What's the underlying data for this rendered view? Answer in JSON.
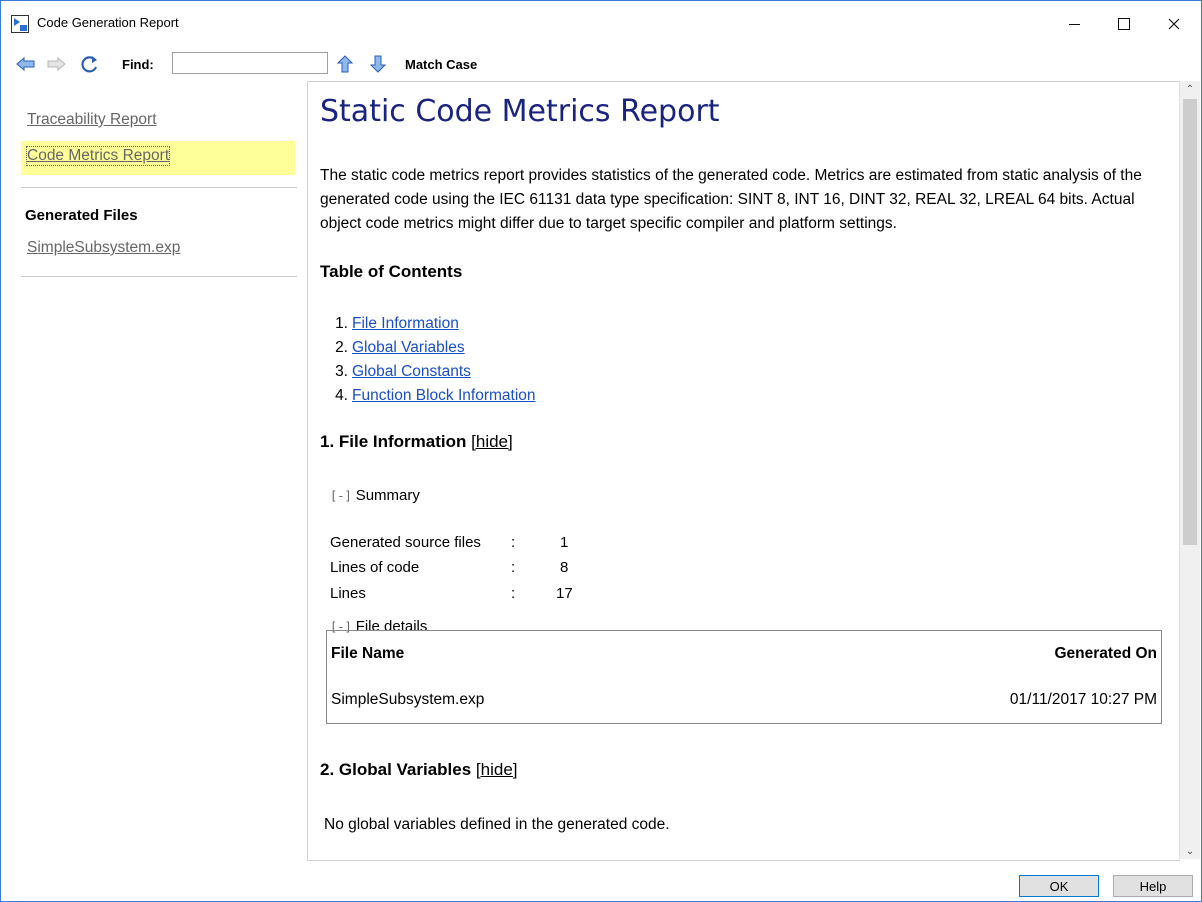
{
  "window": {
    "title": "Code Generation Report"
  },
  "toolbar": {
    "find_label": "Find:",
    "find_value": "",
    "match_case_label": "Match Case"
  },
  "sidebar": {
    "links": [
      {
        "label": "Traceability Report"
      },
      {
        "label": "Code Metrics Report"
      }
    ],
    "generated_files_heading": "Generated Files",
    "files": [
      {
        "label": "SimpleSubsystem.exp"
      }
    ]
  },
  "report": {
    "title": "Static Code Metrics Report",
    "intro": "The static code metrics report provides statistics of the generated code. Metrics are estimated from static analysis of the generated code using the IEC 61131 data type specification: SINT 8, INT 16, DINT 32, REAL 32, LREAL 64 bits. Actual object code metrics might differ due to target specific compiler and platform settings.",
    "toc_heading": "Table of Contents",
    "toc": [
      {
        "num": "1.",
        "label": "File Information"
      },
      {
        "num": "2.",
        "label": "Global Variables"
      },
      {
        "num": "3.",
        "label": "Global Constants"
      },
      {
        "num": "4.",
        "label": "Function Block Information"
      }
    ],
    "section1": {
      "heading": "1. File Information",
      "hide_label": "[hide]",
      "summary_toggle": "[-]",
      "summary_label": "Summary",
      "summary": [
        {
          "label": "Generated source files",
          "sep": ":",
          "value": "1"
        },
        {
          "label": "Lines of code",
          "sep": ":",
          "value": "8"
        },
        {
          "label": "Lines",
          "sep": ":",
          "value": "17"
        }
      ],
      "details_toggle": "[-]",
      "details_label": "File details",
      "table": {
        "headers": [
          "File Name",
          "Generated On"
        ],
        "rows": [
          [
            "SimpleSubsystem.exp",
            "01/11/2017 10:27 PM"
          ]
        ]
      }
    },
    "section2": {
      "heading": "2. Global Variables",
      "hide_label": "[hide]",
      "message": "No global variables defined in the generated code."
    }
  },
  "buttons": {
    "ok": "OK",
    "help": "Help"
  },
  "colors": {
    "title_blue": "#1a237e",
    "link_blue": "#1a4fc4",
    "active_highlight": "#ffff99"
  }
}
